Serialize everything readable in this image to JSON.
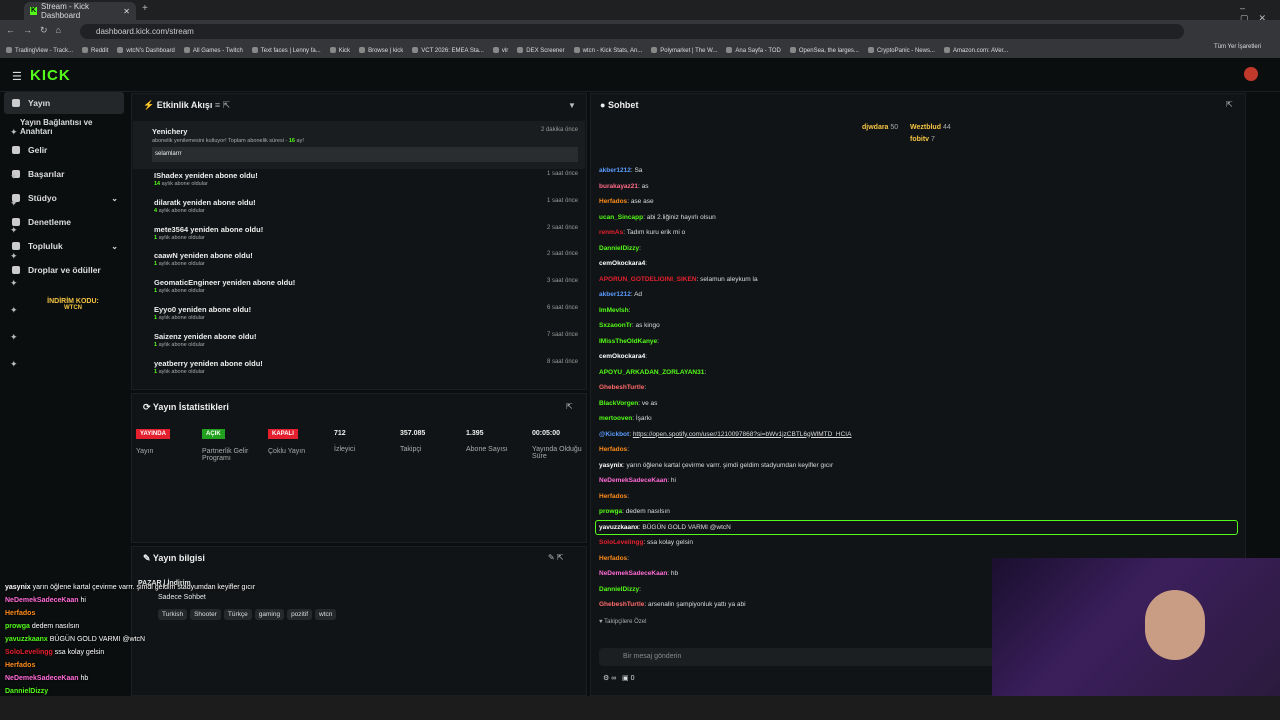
{
  "browser": {
    "tab_title": "Stream - Kick Dashboard",
    "url": "dashboard.kick.com/stream",
    "bookmarks": [
      "TradingView - Track...",
      "Reddit",
      "wtcN's Dashboard",
      "All Games - Twitch",
      "Text faces | Lenny fa...",
      "Kick",
      "Browse | kick",
      "VCT 2026: EMEA Sta...",
      "vlr",
      "DEX Screener",
      "wtcn - Kick Stats, An...",
      "Polymarket | The W...",
      "Ana Sayfa - TOD",
      "OpenSea, the larges...",
      "CryptoPanic - News...",
      "Amazon.com: AVer..."
    ],
    "all_bookmarks": "Tüm Yer İşaretleri"
  },
  "brand": {
    "logo": "KICK",
    "accent": "#53fc18"
  },
  "sidebar": {
    "items": [
      {
        "label": "Yayın"
      },
      {
        "label": "Yayın Bağlantısı ve Anahtarı"
      },
      {
        "label": "Gelir"
      },
      {
        "label": "Başarılar"
      },
      {
        "label": "Stüdyo"
      },
      {
        "label": "Denetleme"
      },
      {
        "label": "Topluluk"
      },
      {
        "label": "Droplar ve ödüller"
      }
    ],
    "promo_line1": "İNDİRİM KODU:",
    "promo_line2": "WTCN"
  },
  "activity": {
    "title": "Etkinlik Akışı",
    "first": {
      "user": "Yenichery",
      "text": "abonelik yenilemesini kutluyor! Toplam abonelik süresi -",
      "months": "16",
      "suffix": "ay!",
      "time": "2 dakika önce",
      "message": "selamlarrr"
    },
    "items": [
      {
        "title": "IShadex yeniden abone oldu!",
        "months": "14",
        "sub": "aylık abone oldular",
        "time": "1 saat önce"
      },
      {
        "title": "dilaratk yeniden abone oldu!",
        "months": "4",
        "sub": "aylık abone oldular",
        "time": "1 saat önce"
      },
      {
        "title": "mete3564 yeniden abone oldu!",
        "months": "1",
        "sub": "aylık abone oldular",
        "time": "2 saat önce"
      },
      {
        "title": "caawN yeniden abone oldu!",
        "months": "1",
        "sub": "aylık abone oldular",
        "time": "2 saat önce"
      },
      {
        "title": "GeomaticEngineer yeniden abone oldu!",
        "months": "1",
        "sub": "aylık abone oldular",
        "time": "3 saat önce"
      },
      {
        "title": "Eyyo0 yeniden abone oldu!",
        "months": "1",
        "sub": "aylık abone oldular",
        "time": "6 saat önce"
      },
      {
        "title": "Saizenz yeniden abone oldu!",
        "months": "1",
        "sub": "aylık abone oldular",
        "time": "7 saat önce"
      },
      {
        "title": "yeatberry yeniden abone oldu!",
        "months": "1",
        "sub": "aylık abone oldular",
        "time": "8 saat önce"
      }
    ]
  },
  "stats": {
    "title": "Yayın İstatistikleri",
    "badges": [
      {
        "badge": "YAYINDA",
        "label": "Yayın",
        "color": "#e5202e"
      },
      {
        "badge": "AÇIK",
        "label": "Partnerlik Gelir Programı",
        "color": "#21a11d"
      },
      {
        "badge": "KAPALI",
        "label": "Çoklu Yayın",
        "color": "#e5202e"
      }
    ],
    "values": [
      {
        "value": "712",
        "label": "İzleyici"
      },
      {
        "value": "357.085",
        "label": "Takipçi"
      },
      {
        "value": "1.395",
        "label": "Abone Sayısı"
      },
      {
        "value": "00:05:00",
        "label": "Yayında Olduğu Süre"
      }
    ]
  },
  "info": {
    "title": "Yayın bilgisi",
    "stream_title": "PAZAR | İndirim",
    "language": "Sadece Sohbet",
    "tags": [
      "Turkish",
      "Shooter",
      "Türkçe",
      "gaming",
      "pozitif",
      "wtcn"
    ]
  },
  "chat": {
    "title": "Sohbet",
    "top": [
      {
        "rank": "1",
        "user": "djwdara",
        "count": "50"
      },
      {
        "user": "Weztblud",
        "count": "44"
      },
      {
        "user": "fobitv",
        "count": "7"
      }
    ],
    "messages": [
      {
        "user": "akber1212",
        "color": "#5b9cff",
        "text": "Sa"
      },
      {
        "user": "burakayaz21",
        "color": "#ff6b8a",
        "text": "as"
      },
      {
        "user": "Herfados",
        "color": "#ff8c1a",
        "text": "ase ase"
      },
      {
        "user": "ucan_Sincapp",
        "color": "#53fc18",
        "text": "abi 2.liğiniz hayırlı olsun"
      },
      {
        "user": "renmAs",
        "color": "#e5202e",
        "text": "Tadım kuru erik mi o"
      },
      {
        "user": "DannielDizzy",
        "color": "#53fc18",
        "text": ""
      },
      {
        "user": "cemOkockara4",
        "color": "#ffffff",
        "text": ""
      },
      {
        "user": "APORUN_GOTDELIGINI_SIKEN",
        "color": "#e5202e",
        "text": "selamun aleykum la"
      },
      {
        "user": "akber1212",
        "color": "#5b9cff",
        "text": "Ad"
      },
      {
        "user": "ImMevlsh",
        "color": "#53fc18",
        "text": ""
      },
      {
        "user": "SxzaoonTr",
        "color": "#53fc18",
        "text": "as kingo"
      },
      {
        "user": "IMissTheOldKanye",
        "color": "#53fc18",
        "text": ""
      },
      {
        "user": "cemOkockara4",
        "color": "#ffffff",
        "text": ""
      },
      {
        "user": "APOYU_ARKADAN_ZORLAYAN31",
        "color": "#53fc18",
        "text": ""
      },
      {
        "user": "GhebeshTurtle",
        "color": "#ff6b6b",
        "text": ""
      },
      {
        "user": "BlackVorgen",
        "color": "#53fc18",
        "text": "ve as"
      },
      {
        "user": "mertooven",
        "color": "#53fc18",
        "text": "İşarkı"
      },
      {
        "user": "@Kickbot",
        "color": "#5b9cff",
        "text": "https://open.spotify.com/user/1210097868?si=bWv1jzCBTL6gWlMTD_HCIA"
      },
      {
        "user": "Herfados",
        "color": "#ff8c1a",
        "text": ""
      },
      {
        "user": "yasynix",
        "color": "#ffffff",
        "text": "yarın öğlene kartal çevirme varrr. şimdi geldim stadyumdan keyifler gıcır"
      },
      {
        "user": "NeDemekSadeceKaan",
        "color": "#ff6bd6",
        "text": "hi"
      },
      {
        "user": "Herfados",
        "color": "#ff8c1a",
        "text": ""
      },
      {
        "user": "prowga",
        "color": "#53fc18",
        "text": "dedem nasılsın"
      },
      {
        "user": "yavuzzkaanx",
        "color": "#ffffff",
        "text": "BÜGÜN GOLD VARMI @wtcN"
      },
      {
        "user": "SoloLevelingg",
        "color": "#e5202e",
        "text": "ssa kolay gelsin"
      },
      {
        "user": "Herfados",
        "color": "#ff8c1a",
        "text": ""
      },
      {
        "user": "NeDemekSadeceKaan",
        "color": "#ff6bd6",
        "text": "hb"
      },
      {
        "user": "DannielDizzy",
        "color": "#53fc18",
        "text": ""
      },
      {
        "user": "GhebeshTurtle",
        "color": "#ff6b6b",
        "text": "arsenalin şampiyonluk yattı ya abi"
      }
    ],
    "followers_only": "Takipçilere Özel",
    "input_placeholder": "Bir mesaj gönderin",
    "footer_count": "0"
  },
  "overlay": [
    {
      "user": "yasynix",
      "color": "#ffffff",
      "text": "yarın öğlene kartal çevirme varrr. şimdi geldim stadyumdan keyifler gıcır"
    },
    {
      "user": "NeDemekSadeceKaan",
      "color": "#ff6bd6",
      "text": "hi"
    },
    {
      "user": "Herfados",
      "color": "#ff8c1a",
      "text": ""
    },
    {
      "user": "prowga",
      "color": "#53fc18",
      "text": "dedem nasılsın"
    },
    {
      "user": "yavuzzkaanx",
      "color": "#53fc18",
      "text": "BÜGÜN GOLD VARMI @wtcN"
    },
    {
      "user": "SoloLevelingg",
      "color": "#e5202e",
      "text": "ssa kolay gelsin"
    },
    {
      "user": "Herfados",
      "color": "#ff8c1a",
      "text": ""
    },
    {
      "user": "NeDemekSadeceKaan",
      "color": "#ff6bd6",
      "text": "hb"
    },
    {
      "user": "DannielDizzy",
      "color": "#53fc18",
      "text": ""
    },
    {
      "user": "GhebeshTurtle",
      "color": "#e5202e",
      "text": "arsenalin şampiyonluk yattı ya abi"
    }
  ]
}
